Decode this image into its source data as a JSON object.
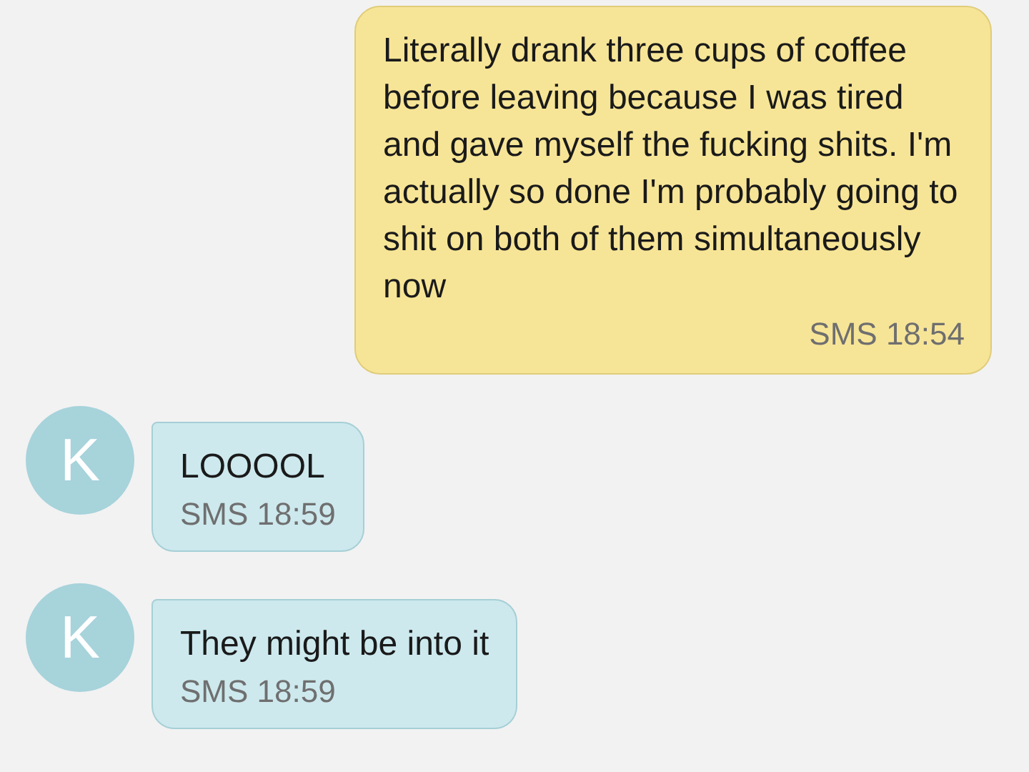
{
  "messages": [
    {
      "kind": "outgoing",
      "text": "Literally drank three cups of coffee before leaving because I was tired and gave myself the fucking shits. I'm actually so done I'm probably going to shit on both of them simultaneously now",
      "meta": "SMS 18:54"
    },
    {
      "kind": "incoming",
      "avatar": "K",
      "text": "LOOOOL",
      "meta": "SMS 18:59"
    },
    {
      "kind": "incoming",
      "avatar": "K",
      "text": "They might be into it",
      "meta": "SMS 18:59"
    }
  ]
}
